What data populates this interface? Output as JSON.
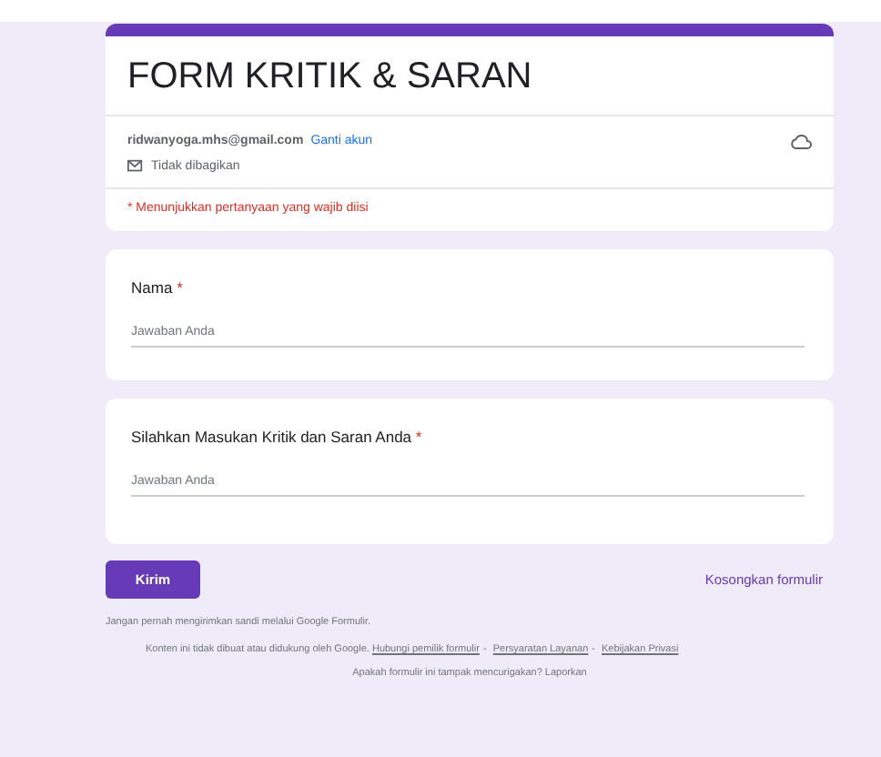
{
  "header": {
    "title": "FORM KRITIK & SARAN",
    "email": "ridwanyoga.mhs@gmail.com",
    "switch_account": "Ganti akun",
    "sharing": "Tidak dibagikan",
    "required_note": "* Menunjukkan pertanyaan yang wajib diisi"
  },
  "questions": [
    {
      "label": "Nama",
      "required_mark": "*",
      "placeholder": "Jawaban Anda"
    },
    {
      "label": "Silahkan Masukan Kritik dan Saran Anda",
      "required_mark": "*",
      "placeholder": "Jawaban Anda"
    }
  ],
  "submit": "Kirim",
  "clear": "Kosongkan formulir",
  "footer": {
    "warning": "Jangan pernah mengirimkan sandi melalui Google Formulir.",
    "disclaimer": "Konten ini tidak dibuat atau didukung oleh Google.",
    "separator": "-",
    "links": [
      "Hubungi pemilik formulir",
      "Persyaratan Layanan",
      "Kebijakan Privasi"
    ],
    "report": "Apakah formulir ini tampak mencurigakan? Laporkan"
  }
}
